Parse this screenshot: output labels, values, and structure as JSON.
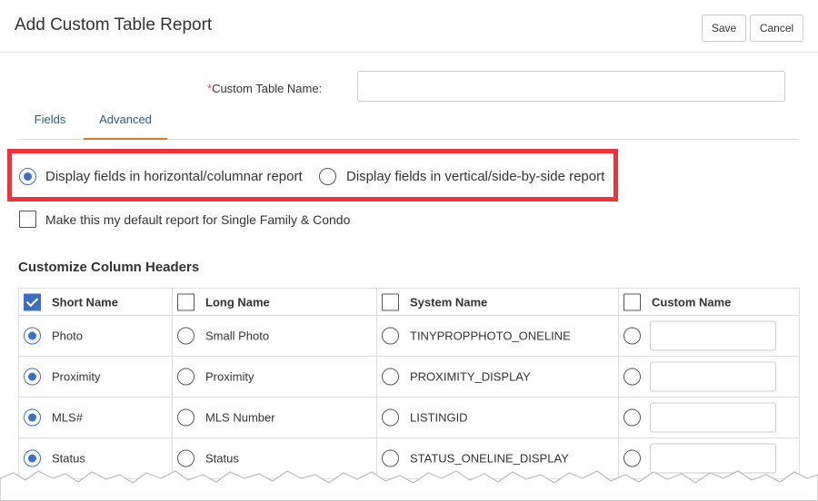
{
  "dialog": {
    "title": "Add Custom Table Report",
    "save_label": "Save",
    "cancel_label": "Cancel"
  },
  "name_field": {
    "required_mark": "*",
    "label": "Custom Table Name:",
    "value": "",
    "placeholder": ""
  },
  "tabs": [
    {
      "label": "Fields",
      "active": false
    },
    {
      "label": "Advanced",
      "active": true
    }
  ],
  "layout_options": [
    {
      "label": "Display fields in horizontal/columnar report",
      "selected": true
    },
    {
      "label": "Display fields in vertical/side-by-side report",
      "selected": false
    }
  ],
  "default_report": {
    "label": "Make this my default report for Single Family & Condo",
    "checked": false
  },
  "column_headers": {
    "section_title": "Customize Column Headers",
    "headers": [
      {
        "label": "Short Name",
        "checked": true
      },
      {
        "label": "Long Name",
        "checked": false
      },
      {
        "label": "System Name",
        "checked": false
      },
      {
        "label": "Custom Name",
        "checked": false
      }
    ],
    "rows": [
      {
        "short": "Photo",
        "long": "Small Photo",
        "system": "TINYPROPPHOTO_ONELINE",
        "custom": "",
        "selected": "short"
      },
      {
        "short": "Proximity",
        "long": "Proximity",
        "system": "PROXIMITY_DISPLAY",
        "custom": "",
        "selected": "short"
      },
      {
        "short": "MLS#",
        "long": "MLS Number",
        "system": "LISTINGID",
        "custom": "",
        "selected": "short"
      },
      {
        "short": "Status",
        "long": "Status",
        "system": "STATUS_ONELINE_DISPLAY",
        "custom": "",
        "selected": "short"
      }
    ]
  },
  "colors": {
    "accent": "#3f6fc2",
    "highlight_border": "#f0333a",
    "active_tab_underline": "#e07a2b",
    "tab_text": "#2a5b84",
    "required": "#d9534f"
  }
}
